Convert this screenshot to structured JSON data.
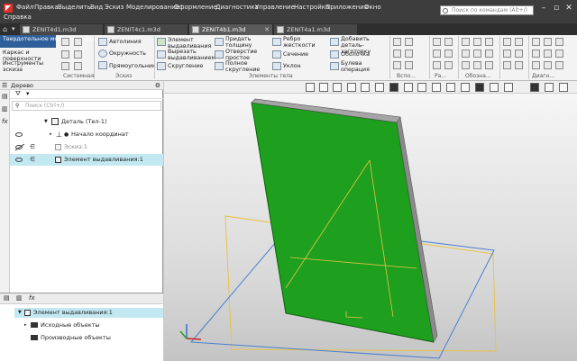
{
  "menu": {
    "items": [
      "Файл",
      "Правка",
      "Выделить",
      "Вид",
      "Эскиз",
      "Моделирование",
      "Оформление",
      "Диагностика",
      "Управление",
      "Настройка",
      "Приложения",
      "Окно"
    ],
    "help": "Справка",
    "search_placeholder": "Поиск по командам (Alt+/)"
  },
  "tabs": [
    {
      "label": "ZENIT4d1.m3d"
    },
    {
      "label": "ZENIT4c1.m3d"
    },
    {
      "label": "ZENIT4b1.m3d"
    },
    {
      "label": "ZENIT4a1.m3d"
    }
  ],
  "ribbon": {
    "modes": [
      "Твердотельное моделирование",
      "Каркас и поверхности",
      "Инструменты эскиза"
    ],
    "cmds": {
      "autoline": "Автолиния",
      "circle": "Окружность",
      "rect": "Прямоугольник",
      "extrude": "Элемент выдавливания",
      "cut": "Вырезать выдавливанием",
      "fillet": "Скругление",
      "thicken": "Придать толщину",
      "hole": "Отверстие простое",
      "full_fillet": "Полное скругление",
      "rib": "Ребро жесткости",
      "section": "Сечение",
      "angle": "Уклон",
      "addpart": "Добавить деталь-заготовку",
      "shell": "Оболочка",
      "bool": "Булева операция"
    },
    "groups": {
      "system": "Системная",
      "sketch": "Эскиз",
      "body": "Элементы тела",
      "aux": "Вспо...",
      "pa": "Ра...",
      "ob": "Обозна...",
      "diag": "Диагн..."
    }
  },
  "tree": {
    "title": "Дерево",
    "search_placeholder": "Поиск (Ctrl+/)",
    "rows": [
      "Деталь (Тел-1)",
      "Начало координат",
      "Эскиз:1",
      "Элемент выдавливания:1"
    ]
  },
  "bottom": {
    "rows": [
      "Элемент выдавливания:1",
      "Исходные объекты",
      "Производные объекты"
    ]
  },
  "colors": {
    "accent": "#1ea01e",
    "selection": "#c2e8f2",
    "menubar": "#3d3d3d"
  }
}
